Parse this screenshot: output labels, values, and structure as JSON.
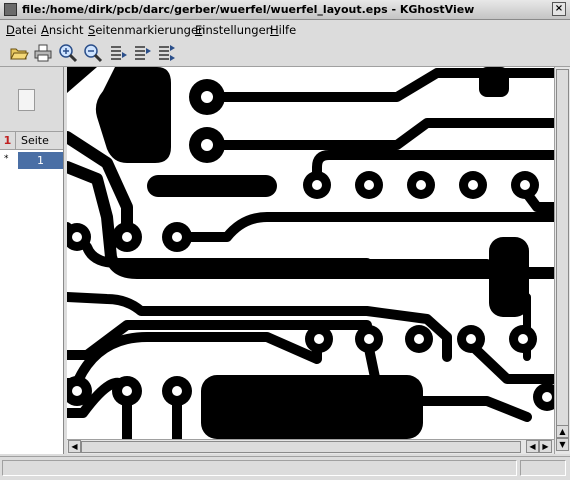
{
  "window": {
    "title": "file:/home/dirk/pcb/darc/gerber/wuerfel/wuerfel_layout.eps - KGhostView",
    "close_symbol": "×"
  },
  "menu": [
    {
      "accel": "D",
      "rest": "atei"
    },
    {
      "accel": "A",
      "rest": "nsicht"
    },
    {
      "accel": "S",
      "rest": "eitenmarkierungen"
    },
    {
      "accel": "E",
      "rest": "instellungen"
    },
    {
      "accel": "H",
      "rest": "ilfe"
    }
  ],
  "toolbar": {
    "icons": [
      "open-folder-icon",
      "print-icon",
      "zoom-in-icon",
      "zoom-out-icon",
      "mark-page-icon",
      "mark-page-list-icon",
      "mark-page-all-icon"
    ]
  },
  "sidebar": {
    "mark_column_header": "1",
    "page_column_header": "Seite",
    "pages": [
      {
        "mark": "*",
        "number": "1"
      }
    ]
  },
  "colors": {
    "selection": "#4a6fa5",
    "copper": "#000000",
    "board": "#ffffff"
  },
  "scrollbars": {
    "up": "▲",
    "down": "▼",
    "left": "◀",
    "right": "▶"
  }
}
